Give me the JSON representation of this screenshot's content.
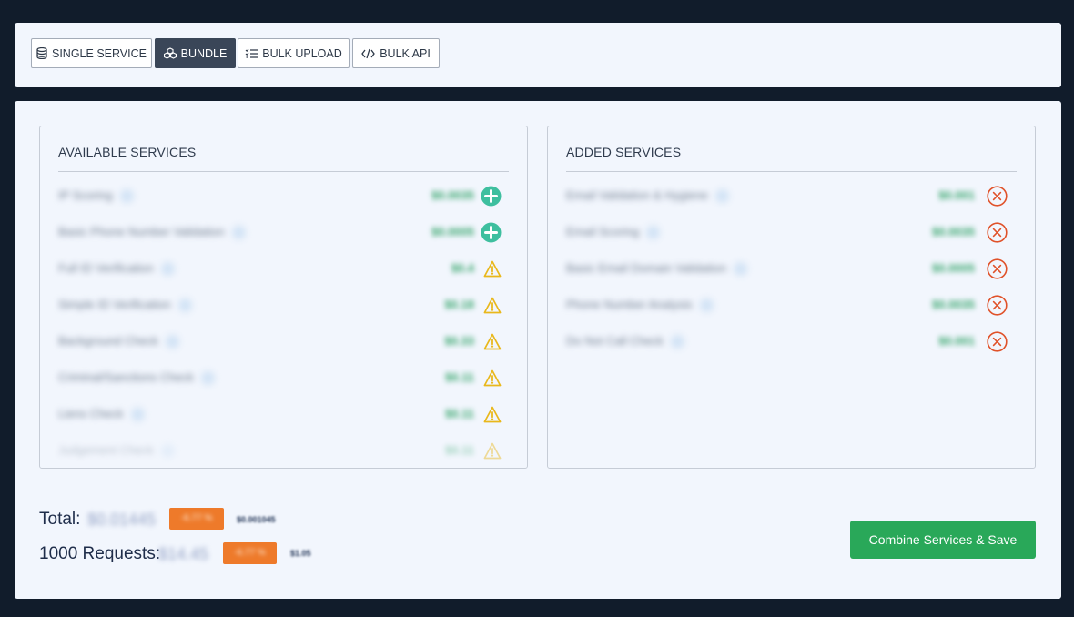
{
  "tabs": [
    {
      "label": "SINGLE SERVICE",
      "icon": "database-icon",
      "active": false
    },
    {
      "label": "BUNDLE",
      "icon": "cubes-icon",
      "active": true
    },
    {
      "label": "BULK UPLOAD",
      "icon": "checklist-icon",
      "active": false
    },
    {
      "label": "BULK API",
      "icon": "code-icon",
      "active": false
    }
  ],
  "available": {
    "title": "AVAILABLE SERVICES",
    "items": [
      {
        "name": "IP Scoring",
        "price": "$0.0035",
        "action": "plus-circle-icon"
      },
      {
        "name": "Basic Phone Number Validation",
        "price": "$0.0005",
        "action": "plus-circle-icon"
      },
      {
        "name": "Full ID Verification",
        "price": "$0.4",
        "action": "warning-icon"
      },
      {
        "name": "Simple ID Verification",
        "price": "$0.18",
        "action": "warning-icon"
      },
      {
        "name": "Background Check",
        "price": "$0.33",
        "action": "warning-icon"
      },
      {
        "name": "Criminal/Sanctions Check",
        "price": "$0.11",
        "action": "warning-icon"
      },
      {
        "name": "Liens Check",
        "price": "$0.11",
        "action": "warning-icon"
      },
      {
        "name": "Judgement Check",
        "price": "$0.11",
        "action": "warning-icon"
      }
    ]
  },
  "added": {
    "title": "ADDED SERVICES",
    "items": [
      {
        "name": "Email Validation & Hygiene",
        "price": "$0.001",
        "action": "remove-circle-icon"
      },
      {
        "name": "Email Scoring",
        "price": "$0.0035",
        "action": "remove-circle-icon"
      },
      {
        "name": "Basic Email Domain Validation",
        "price": "$0.0005",
        "action": "remove-circle-icon"
      },
      {
        "name": "Phone Number Analysis",
        "price": "$0.0035",
        "action": "remove-circle-icon"
      },
      {
        "name": "Do Not Call Check",
        "price": "$0.001",
        "action": "remove-circle-icon"
      }
    ]
  },
  "totals": {
    "total_label": "Total:",
    "total_value": "$0.01445",
    "total_badge": "-6.77 %",
    "total_saving": "$0.001045",
    "requests_label": "1000 Requests:",
    "requests_value": "$14.45",
    "requests_badge": "-6.77 %",
    "requests_saving": "$1.05"
  },
  "combine_button": "Combine Services & Save",
  "colors": {
    "background": "#111c2b",
    "card": "#f2f6fd",
    "active_tab": "#3a4658",
    "add_icon": "#3ebf9f",
    "warning_icon": "#e9b81c",
    "remove_icon": "#e0522a",
    "price": "#34a46a",
    "badge": "#ee7a2a",
    "combine_button": "#29a859"
  }
}
